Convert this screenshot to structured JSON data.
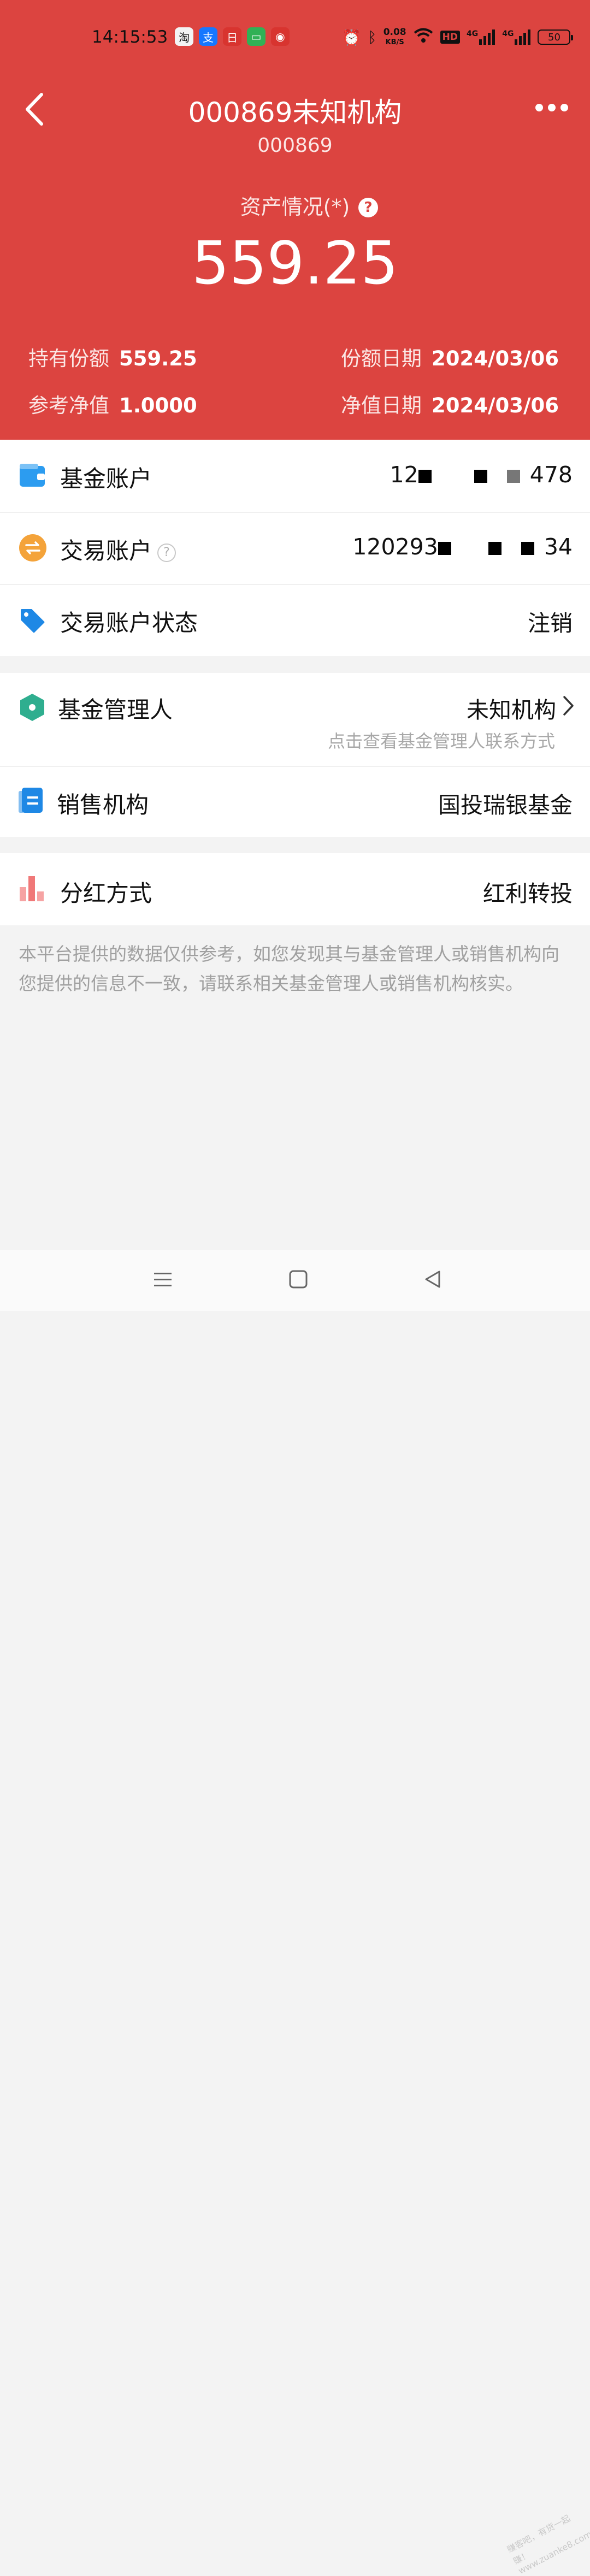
{
  "status": {
    "time": "14:15:53",
    "apps": [
      {
        "name": "taobao-app-icon",
        "glyph": "淘",
        "color": "#f3f3f3",
        "text_color": "#111"
      },
      {
        "name": "alipay-app-icon",
        "glyph": "支",
        "color": "#1677ff"
      },
      {
        "name": "app-icon-3",
        "glyph": "日",
        "color": "#d8342f"
      },
      {
        "name": "messages-app-icon",
        "glyph": "▭",
        "color": "#31b155"
      },
      {
        "name": "app-icon-5",
        "glyph": "◉",
        "color": "#d8342f"
      }
    ],
    "net_speed": "0.08",
    "net_unit": "KB/S",
    "hd": "HD",
    "signal_1": "4G",
    "signal_2": "4G",
    "battery": "50"
  },
  "header": {
    "title": "000869未知机构",
    "code": "000869",
    "asset_label": "资产情况(*)",
    "asset_help": "?",
    "asset_value": "559.25",
    "stats": {
      "shares_label": "持有份额",
      "shares_value": "559.25",
      "shares_date_label": "份额日期",
      "shares_date_value": "2024/03/06",
      "nav_label": "参考净值",
      "nav_value": "1.0000",
      "nav_date_label": "净值日期",
      "nav_date_value": "2024/03/06"
    }
  },
  "account": {
    "fund_account_label": "基金账户",
    "fund_account_prefix": "12",
    "fund_account_suffix": "478",
    "trade_account_label": "交易账户",
    "trade_account_help": "?",
    "trade_account_prefix": "120293",
    "trade_account_suffix": "34",
    "trade_status_label": "交易账户状态",
    "trade_status_value": "注销"
  },
  "manager": {
    "manager_label": "基金管理人",
    "manager_value": "未知机构",
    "manager_hint": "点击查看基金管理人联系方式",
    "sales_label": "销售机构",
    "sales_value": "国投瑞银基金"
  },
  "dividend": {
    "label": "分红方式",
    "value": "红利转投"
  },
  "notice": "本平台提供的数据仅供参考，如您发现其与基金管理人或销售机构向您提供的信息不一致，请联系相关基金管理人或销售机构核实。",
  "watermark": "赚客吧，有货一起赚！ www.zuanke8.com",
  "colors": {
    "header_bg": "#dc4440",
    "wallet_icon": "#2c9cf0",
    "exchange_icon": "#f4a33a",
    "tag_icon": "#1e88e5",
    "hex_icon": "#2fae8f",
    "bar_icon": "#f07878"
  }
}
